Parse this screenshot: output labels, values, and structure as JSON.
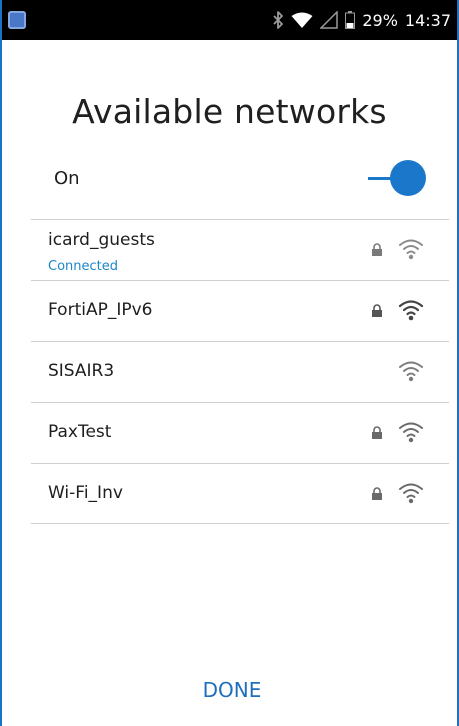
{
  "status_bar": {
    "battery_percent": "29%",
    "time": "14:37",
    "icons": [
      "app-notification-icon",
      "bluetooth-icon",
      "wifi-signal-icon",
      "cell-signal-icon",
      "battery-icon"
    ]
  },
  "title": "Available networks",
  "wifi_toggle": {
    "label": "On",
    "state": "on",
    "accent_color": "#1b77c9"
  },
  "networks": [
    {
      "ssid": "icard_guests",
      "status": "Connected",
      "secured": true
    },
    {
      "ssid": "FortiAP_IPv6",
      "status": "",
      "secured": true
    },
    {
      "ssid": "SISAIR3",
      "status": "",
      "secured": false
    },
    {
      "ssid": "PaxTest",
      "status": "",
      "secured": true
    },
    {
      "ssid": "Wi-Fi_Inv",
      "status": "",
      "secured": true
    }
  ],
  "done_label": "DONE",
  "colors": {
    "status_bar_bg": "#000000",
    "accent": "#1b77c9",
    "connected_text": "#1d86c8",
    "frame": "#1a73c6"
  }
}
